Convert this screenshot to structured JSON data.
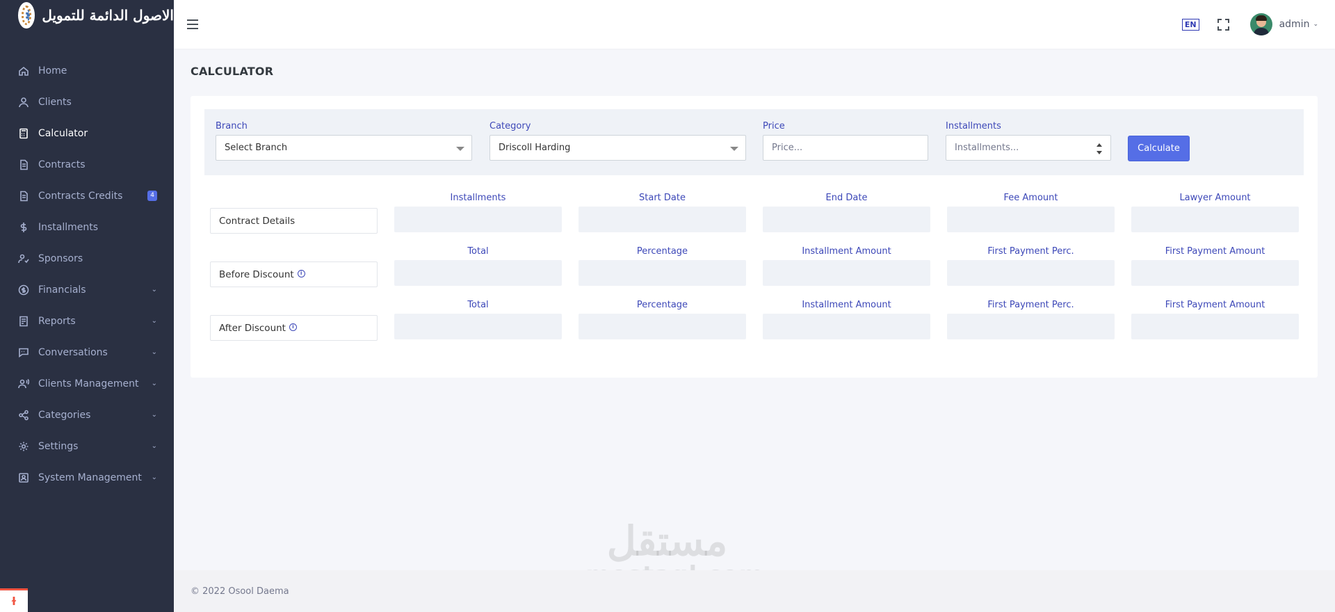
{
  "brand": {
    "name": "الاصول الدائمة للتمويل"
  },
  "sidebar": {
    "items": [
      {
        "label": "Home",
        "icon": "home-icon"
      },
      {
        "label": "Clients",
        "icon": "user-icon"
      },
      {
        "label": "Calculator",
        "icon": "calculator-icon",
        "active": true
      },
      {
        "label": "Contracts",
        "icon": "document-icon"
      },
      {
        "label": "Contracts Credits",
        "icon": "document-icon",
        "badge": "4"
      },
      {
        "label": "Installments",
        "icon": "dollar-icon"
      },
      {
        "label": "Sponsors",
        "icon": "user-check-icon"
      },
      {
        "label": "Financials",
        "icon": "coin-icon",
        "expandable": true
      },
      {
        "label": "Reports",
        "icon": "report-icon",
        "expandable": true
      },
      {
        "label": "Conversations",
        "icon": "chat-icon",
        "expandable": true
      },
      {
        "label": "Clients Management",
        "icon": "user-voice-icon",
        "expandable": true
      },
      {
        "label": "Categories",
        "icon": "share-icon",
        "expandable": true
      },
      {
        "label": "Settings",
        "icon": "gear-icon",
        "expandable": true
      },
      {
        "label": "System Management",
        "icon": "id-card-icon",
        "expandable": true
      }
    ]
  },
  "topbar": {
    "lang": "EN",
    "user": "admin"
  },
  "page": {
    "title": "CALCULATOR"
  },
  "form": {
    "branch": {
      "label": "Branch",
      "value": "Select Branch"
    },
    "category": {
      "label": "Category",
      "value": "Driscoll Harding"
    },
    "price": {
      "label": "Price",
      "placeholder": "Price..."
    },
    "installments": {
      "label": "Installments",
      "placeholder": "Installments..."
    },
    "calculate_label": "Calculate"
  },
  "results": {
    "rows": [
      {
        "label": "Contract Details",
        "info": false,
        "columns": [
          "Installments",
          "Start Date",
          "End Date",
          "Fee Amount",
          "Lawyer Amount"
        ]
      },
      {
        "label": "Before Discount",
        "info": true,
        "columns": [
          "Total",
          "Percentage",
          "Installment Amount",
          "First Payment Perc.",
          "First Payment Amount"
        ]
      },
      {
        "label": "After Discount",
        "info": true,
        "columns": [
          "Total",
          "Percentage",
          "Installment Amount",
          "First Payment Perc.",
          "First Payment Amount"
        ]
      }
    ]
  },
  "footer": {
    "text": "© 2022 Osool Daema"
  },
  "watermark": {
    "arabic": "مستقل",
    "latin": "mostaql.com"
  },
  "colors": {
    "sidebar_bg": "#2a3042",
    "accent": "#556ee6",
    "label_blue": "#3d48b8"
  }
}
